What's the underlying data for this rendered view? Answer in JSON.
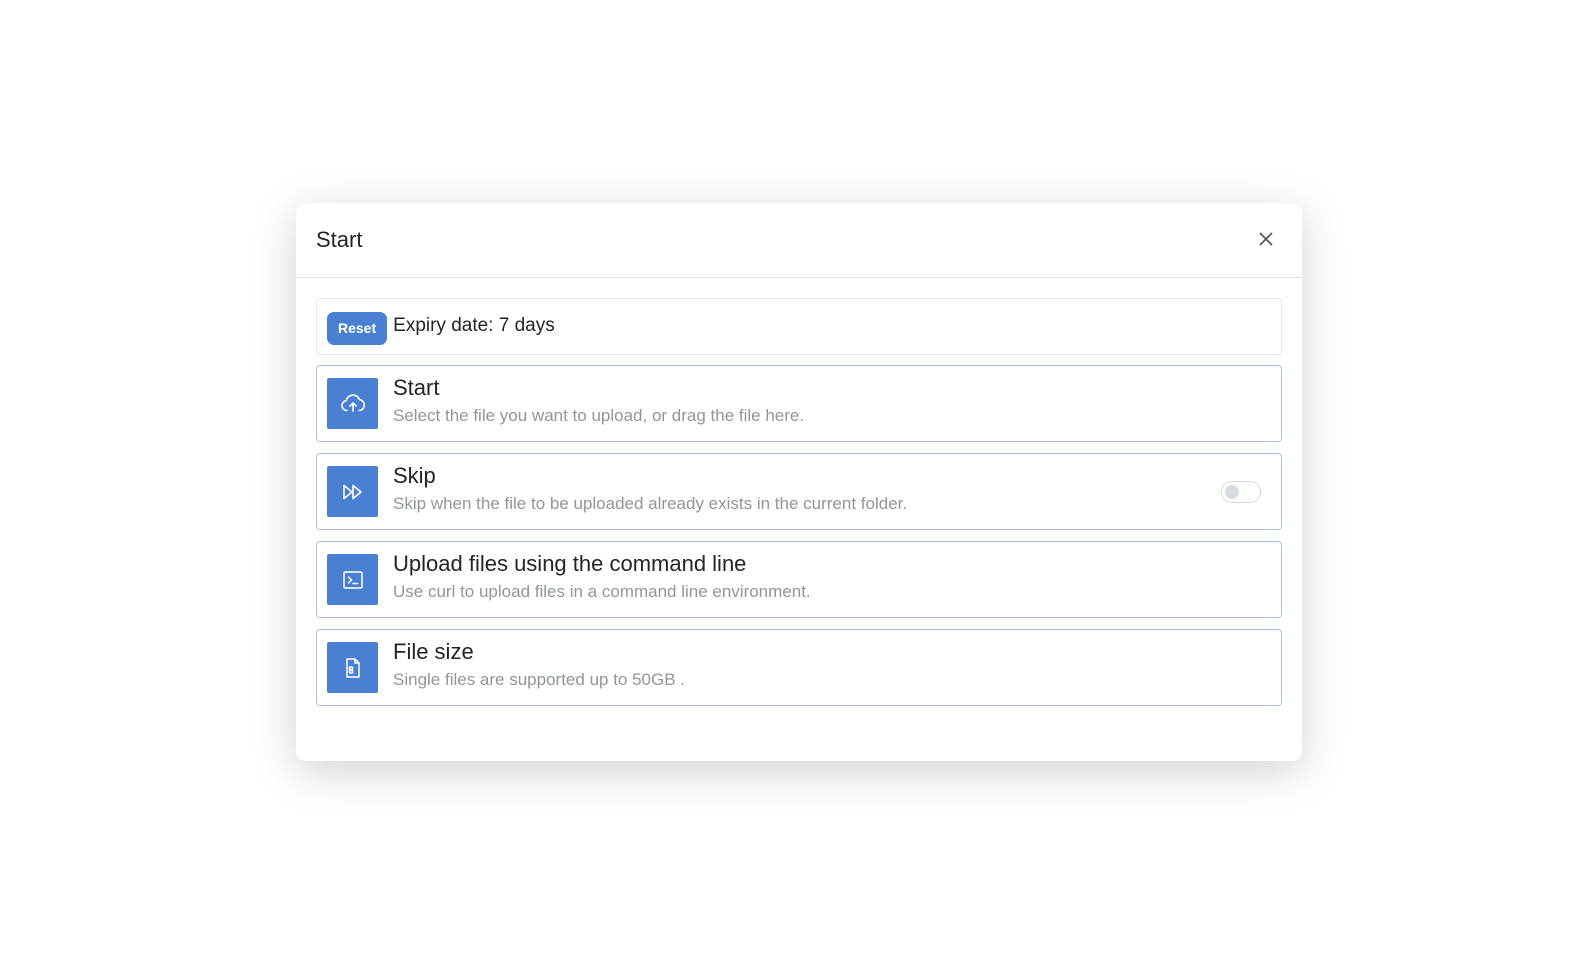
{
  "modal": {
    "title": "Start",
    "close_label": "×"
  },
  "expiry": {
    "reset_label": "Reset",
    "text": "Expiry date: 7 days"
  },
  "cards": [
    {
      "icon": "cloud-upload-icon",
      "title": "Start",
      "description": "Select the file you want to upload, or drag the file here."
    },
    {
      "icon": "fast-forward-icon",
      "title": "Skip",
      "description": "Skip when the file to be uploaded already exists in the current folder.",
      "toggle_on": false
    },
    {
      "icon": "terminal-icon",
      "title": "Upload files using the command line",
      "description": "Use curl to upload files in a command line environment."
    },
    {
      "icon": "file-icon",
      "title": "File size",
      "description": "Single files are supported up to 50GB ."
    }
  ],
  "colors": {
    "accent": "#4a80d4",
    "card_border": "#a9c0e6",
    "muted_text": "#8f969d"
  }
}
